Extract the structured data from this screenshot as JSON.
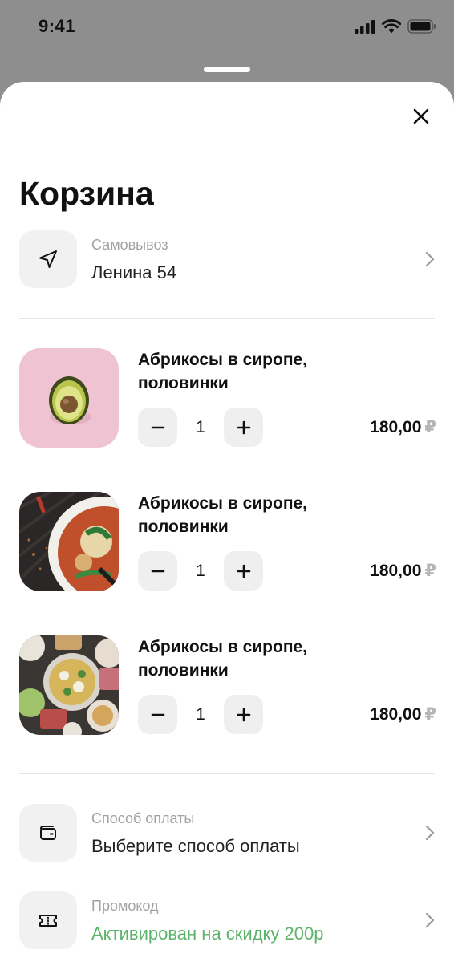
{
  "status_bar": {
    "time": "9:41"
  },
  "cart": {
    "title": "Корзина",
    "delivery": {
      "caption": "Самовывоз",
      "value": "Ленина 54"
    },
    "currency": "₽",
    "items": [
      {
        "name": "Абрикосы в сиропе, половинки",
        "quantity": "1",
        "price": "180,00",
        "image": "avocado-photo"
      },
      {
        "name": "Абрикосы в сиропе, половинки",
        "quantity": "1",
        "price": "180,00",
        "image": "soup-photo"
      },
      {
        "name": "Абрикосы в сиропе, половинки",
        "quantity": "1",
        "price": "180,00",
        "image": "hotpot-photo"
      }
    ],
    "payment": {
      "caption": "Способ оплаты",
      "value": "Выберите способ оплаты"
    },
    "promo": {
      "caption": "Промокод",
      "value": "Активирован на скидку 200р"
    }
  },
  "colors": {
    "promo_active": "#5cb36a",
    "tile_bg": "#f1f1f1",
    "stepper_bg": "#efefef",
    "overlay": "#8e8e8e"
  },
  "icons": {
    "delivery": "navigation-arrow-icon",
    "payment": "wallet-icon",
    "promo": "ticket-icon",
    "close": "close-icon"
  }
}
